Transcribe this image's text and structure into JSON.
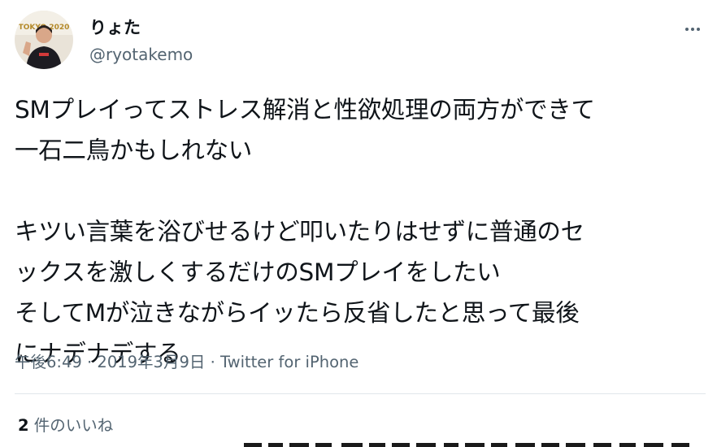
{
  "user": {
    "display_name": "りょた",
    "handle": "@ryotakemo",
    "avatar_backdrop_text": "TOKYO 2020"
  },
  "more_menu": {
    "icon": "more-horizontal-icon"
  },
  "tweet": {
    "lines": [
      "SMプレイってストレス解消と性欲処理の両方ができて",
      "一石二鳥かもしれない",
      "",
      "キツい言葉を浴びせるけど叩いたりはせずに普通のセ",
      "ックスを激しくするだけのSMプレイをしたい",
      "そしてMが泣きながらイッたら反省したと思って最後",
      "にナデナデする"
    ],
    "time": "午後6:49",
    "separator": "·",
    "date": "2019年3月9日",
    "source": "Twitter for iPhone"
  },
  "stats": {
    "like_count": "2",
    "like_label": "件のいいね"
  },
  "colors": {
    "text": "#0f1419",
    "secondary": "#536471",
    "divider": "#e1e6ea",
    "background": "#ffffff"
  }
}
